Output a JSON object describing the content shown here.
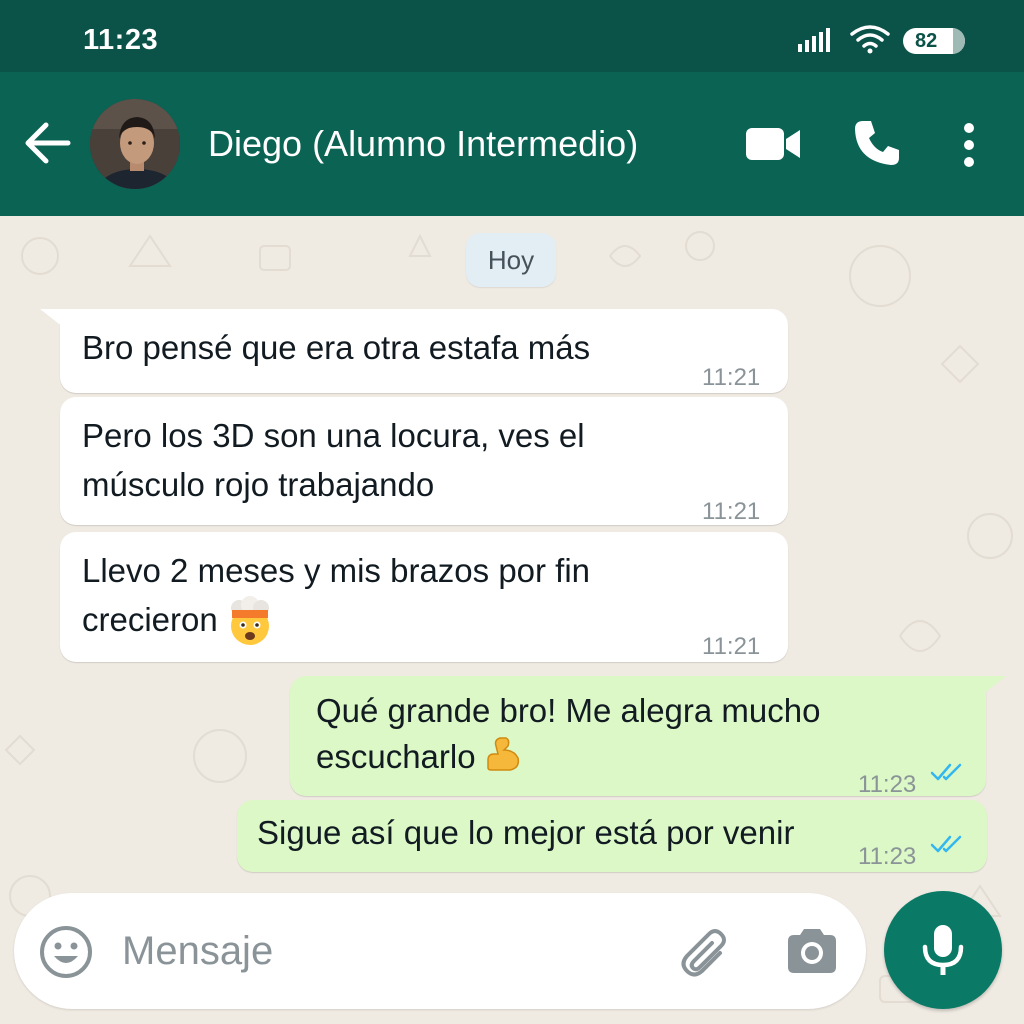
{
  "status_bar": {
    "time": "11:23",
    "battery": "82"
  },
  "header": {
    "contact_name": "Diego (Alumno Intermedio)"
  },
  "chat": {
    "date_label": "Hoy",
    "messages": [
      {
        "direction": "incoming",
        "lines": [
          "Bro pensé que era otra estafa más"
        ],
        "time": "11:21"
      },
      {
        "direction": "incoming",
        "lines": [
          "Pero los 3D son una locura, ves el",
          "músculo rojo trabajando"
        ],
        "time": "11:21"
      },
      {
        "direction": "incoming",
        "lines": [
          "Llevo 2 meses y mis brazos por fin",
          "crecieron"
        ],
        "emoji": "exploding-head",
        "time": "11:21"
      },
      {
        "direction": "outgoing",
        "lines": [
          "Qué grande bro! Me alegra mucho",
          "escucharlo"
        ],
        "emoji": "flexed-biceps",
        "time": "11:23",
        "status": "read"
      },
      {
        "direction": "outgoing",
        "lines": [
          "Sigue así que lo mejor está por venir"
        ],
        "time": "11:23",
        "status": "read"
      }
    ]
  },
  "composer": {
    "placeholder": "Mensaje"
  },
  "icons": {
    "back": "arrow-left-icon",
    "video": "videocam-icon",
    "call": "phone-icon",
    "menu": "more-vert-icon",
    "emoji": "emoji-icon",
    "attach": "paperclip-icon",
    "camera": "camera-icon",
    "mic": "microphone-icon",
    "read_receipt": "double-check-icon"
  },
  "colors": {
    "header": "#0b6354",
    "status_bar": "#0b5249",
    "chat_bg": "#efeae2",
    "incoming_bubble": "#ffffff",
    "outgoing_bubble": "#dcf8c6",
    "read_tick": "#34b7f1",
    "mic_button": "#0a7a66"
  }
}
